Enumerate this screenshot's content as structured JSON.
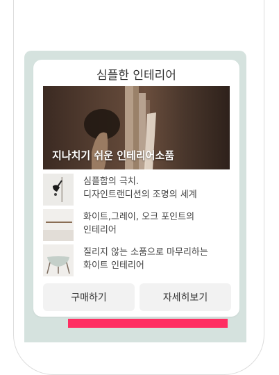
{
  "card": {
    "title": "심플한 인테리어",
    "hero_caption": "지나치기 쉬운 인테리어소품",
    "items": [
      {
        "thumb_icon": "wall-lamp-thumbnail",
        "lines": [
          "심플함의 극치.",
          "디자인트랜디션의 조명의 세계"
        ]
      },
      {
        "thumb_icon": "shelf-thumbnail",
        "lines": [
          "화이트,그레이, 오크 포인트의",
          "인테리어"
        ]
      },
      {
        "thumb_icon": "glass-table-thumbnail",
        "lines": [
          "질리지 않는 소품으로 마무리하는",
          "화이트 인테리어"
        ]
      }
    ],
    "buy_label": "구매하기",
    "detail_label": "자세히보기"
  },
  "colors": {
    "mint_background": "#d5e2de",
    "accent_bar": "#ff2e62"
  }
}
